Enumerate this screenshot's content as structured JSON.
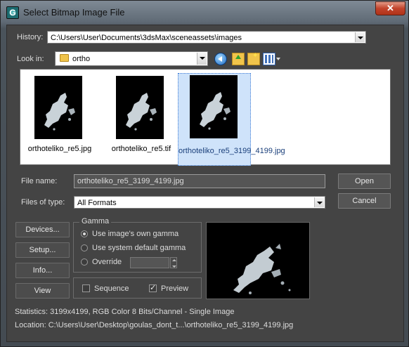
{
  "window": {
    "title": "Select Bitmap Image File",
    "close_symbol": "✕"
  },
  "history": {
    "label": "History:",
    "value": "C:\\Users\\User\\Documents\\3dsMax\\sceneassets\\images"
  },
  "look_in": {
    "label": "Look in:",
    "value": "ortho"
  },
  "toolbar": {
    "icons": [
      "back-icon",
      "up-folder-icon",
      "new-folder-icon",
      "view-menu-icon"
    ]
  },
  "files": [
    {
      "name": "orthoteliko_re5.jpg",
      "selected": false
    },
    {
      "name": "orthoteliko_re5.tif",
      "selected": false
    },
    {
      "name": "orthoteliko_re5_3199_4199.jpg",
      "selected": true
    }
  ],
  "file_name": {
    "label": "File name:",
    "value": "orthoteliko_re5_3199_4199.jpg"
  },
  "files_of_type": {
    "label": "Files of type:",
    "value": "All Formats"
  },
  "buttons": {
    "open": "Open",
    "cancel": "Cancel",
    "devices": "Devices...",
    "setup": "Setup...",
    "info": "Info...",
    "view": "View"
  },
  "gamma": {
    "title": "Gamma",
    "options": [
      "Use image's own gamma",
      "Use system default gamma",
      "Override"
    ],
    "selected_index": 0
  },
  "sequence": {
    "label": "Sequence",
    "checked": false
  },
  "preview_check": {
    "label": "Preview",
    "checked": true
  },
  "statistics": "Statistics:  3199x4199, RGB Color 8 Bits/Channel - Single Image",
  "location": "Location:  C:\\Users\\User\\Desktop\\goulas_dont_t...\\orthoteliko_re5_3199_4199.jpg"
}
